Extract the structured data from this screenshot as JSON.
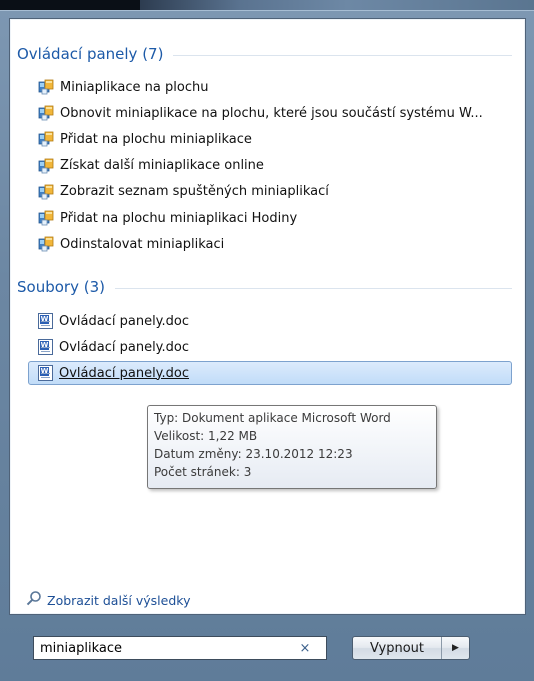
{
  "control_panel": {
    "title": "Ovládací panely (7)",
    "items": [
      {
        "label": "Miniaplikace na plochu",
        "icon": "control-panel-icon"
      },
      {
        "label": "Obnovit miniaplikace na plochu, které jsou součástí systému W...",
        "icon": "control-panel-icon"
      },
      {
        "label": "Přidat na plochu miniaplikace",
        "icon": "control-panel-icon"
      },
      {
        "label": "Získat další miniaplikace online",
        "icon": "control-panel-icon"
      },
      {
        "label": "Zobrazit seznam spuštěných miniaplikací",
        "icon": "control-panel-icon"
      },
      {
        "label": "Přidat na plochu miniaplikaci Hodiny",
        "icon": "control-panel-icon"
      },
      {
        "label": "Odinstalovat miniaplikaci",
        "icon": "control-panel-icon"
      }
    ]
  },
  "files": {
    "title": "Soubory (3)",
    "items": [
      {
        "label": "Ovládací panely.doc",
        "icon": "word-document-icon"
      },
      {
        "label": "Ovládací panely.doc",
        "icon": "word-document-icon"
      },
      {
        "label": "Ovládací panely.doc",
        "icon": "word-document-icon",
        "selected": true
      }
    ]
  },
  "tooltip": {
    "type": "Typ: Dokument aplikace Microsoft Word",
    "size": "Velikost: 1,22 MB",
    "modified": "Datum změny: 23.10.2012 12:23",
    "pages": "Počet stránek: 3"
  },
  "more_results": {
    "label": "Zobrazit další výsledky",
    "icon": "search-icon"
  },
  "search": {
    "value": "miniaplikace",
    "clear_glyph": "×"
  },
  "shutdown": {
    "label": "Vypnout",
    "arrow_glyph": "▶"
  },
  "colors": {
    "group_title": "#1d5aa8",
    "selection": "#c1dcf8",
    "link": "#1d4f96"
  }
}
